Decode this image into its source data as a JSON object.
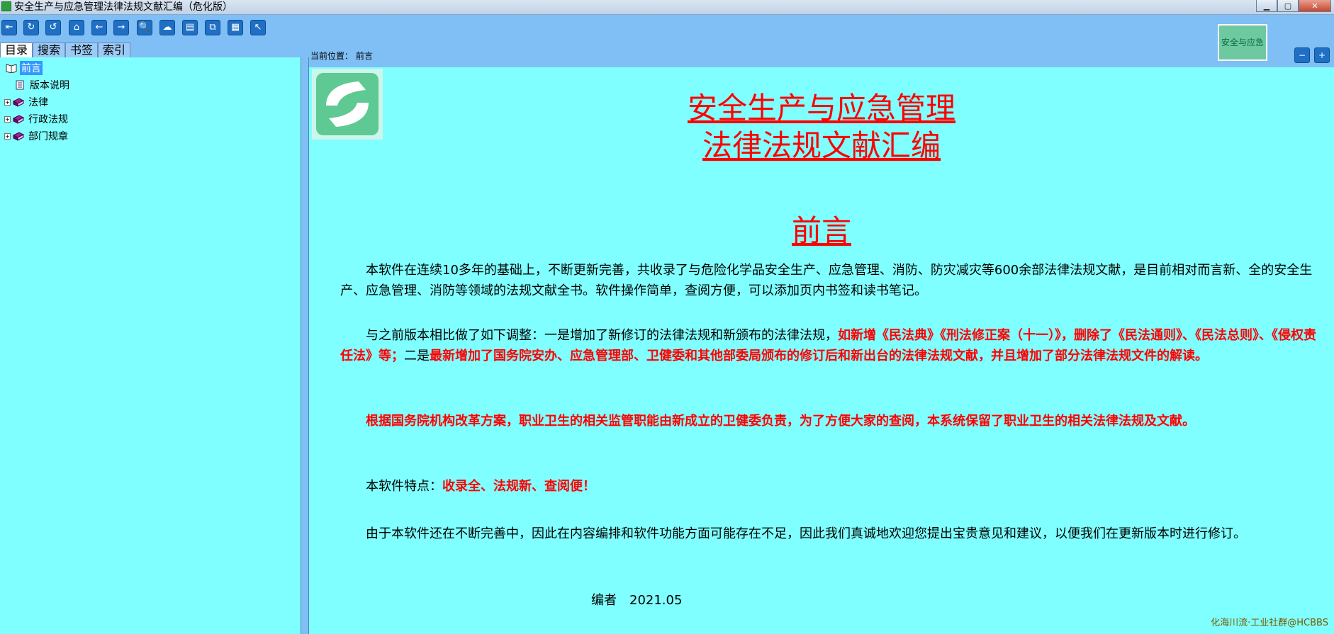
{
  "window": {
    "title": "安全生产与应急管理法律法规文献汇编（危化版）",
    "minimize": "▁",
    "maximize": "▢",
    "close": "✕"
  },
  "toolbar": {
    "buttons": [
      "⇤",
      "↻",
      "↺",
      "⌂",
      "←",
      "→",
      "🔍",
      "☁",
      "▤",
      "⧉",
      "▦",
      "↖"
    ]
  },
  "tabs": [
    "目录",
    "搜索",
    "书签",
    "索引"
  ],
  "tree": [
    {
      "label": "前言",
      "expand": "",
      "selected": true
    },
    {
      "label": "版本说明",
      "expand": "",
      "selected": false
    },
    {
      "label": "法律",
      "expand": "+",
      "selected": false
    },
    {
      "label": "行政法规",
      "expand": "+",
      "selected": false
    },
    {
      "label": "部门规章",
      "expand": "+",
      "selected": false
    }
  ],
  "location": "当前位置： 前言",
  "badge": "安全与应急",
  "zoom": [
    "−",
    "+"
  ],
  "doc": {
    "title1": "安全生产与应急管理",
    "title2": "法律法规文献汇编",
    "heading": "前言",
    "p1": "本软件在连续10多年的基础上，不断更新完善，共收录了与危险化学品安全生产、应急管理、消防、防灾减灾等600余部法律法规文献，是目前相对而言新、全的安全生产、应急管理、消防等领域的法规文献全书。软件操作简单，查阅方便，可以添加页内书签和读书笔记。",
    "p2a": "与之前版本相比做了如下调整：一是增加了新修订的法律法规和新颁布的法律法规，",
    "p2b": "如新增《民法典》《刑法修正案（十一）》，删除了《民法通则》、《民法总则》、《侵权责任法》等；",
    "p2c": "二是",
    "p2d": "最新增加了国务院安办、应急管理部、卫健委和其他部委局颁布的修订后和新出台的法律法规文献，并且增加了部分法律法规文件的解读。",
    "p3": "根据国务院机构改革方案，职业卫生的相关监管职能由新成立的卫健委负责，为了方便大家的查阅，本系统保留了职业卫生的相关法律法规及文献。",
    "p4a": "本软件特点：",
    "p4b": "收录全、法规新、查阅便！",
    "p5": "由于本软件还在不断完善中，因此在内容编排和软件功能方面可能存在不足，因此我们真诚地欢迎您提出宝贵意见和建议，以便我们在更新版本时进行修订。",
    "signoff": "编者　2021.05"
  },
  "watermark": "化海川流·工业社群@HCBBS"
}
